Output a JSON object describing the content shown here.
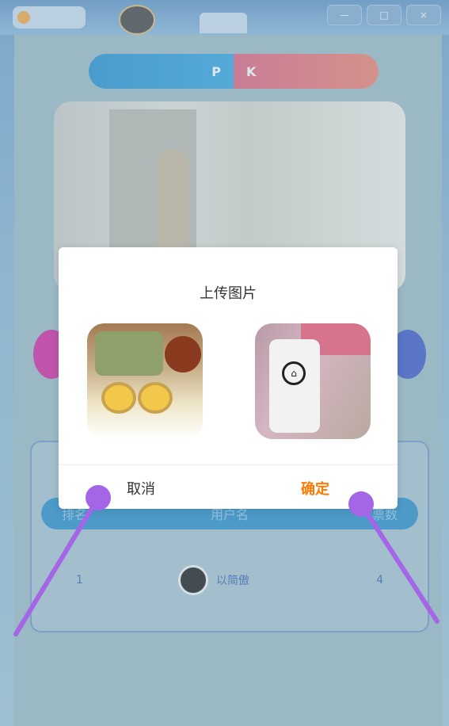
{
  "window": {
    "controls": [
      "—",
      "□",
      "×"
    ]
  },
  "pk": {
    "left": "P",
    "right": "K"
  },
  "ranking": {
    "columns": [
      "排名",
      "用户名",
      "票数"
    ],
    "rows": [
      {
        "rank": "1",
        "user": "以简傲",
        "votes": "4"
      }
    ]
  },
  "modal": {
    "title": "上传图片",
    "cancel_label": "取消",
    "confirm_label": "确定"
  },
  "colors": {
    "accent_orange": "#ff7b00",
    "pk_blue": "#1c8bd0",
    "pk_pink": "#e05a7a",
    "annotation_purple": "#a466e6"
  },
  "icons": {
    "app_logo": "app-logo-icon",
    "minimize": "minimize-icon",
    "maximize": "maximize-icon",
    "close": "close-icon"
  }
}
